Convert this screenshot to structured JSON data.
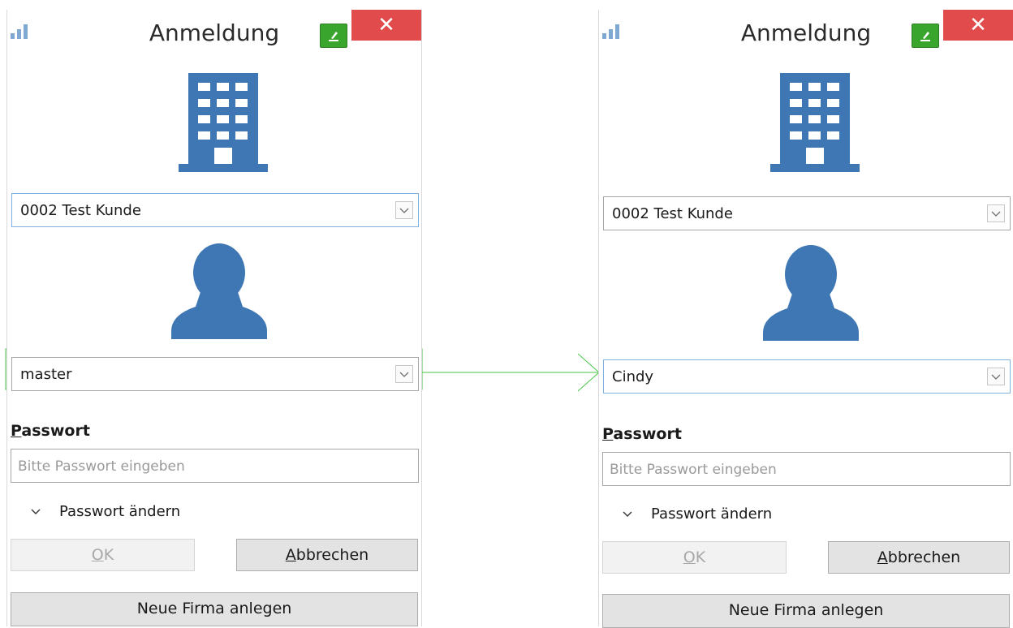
{
  "dialogs": [
    {
      "title": "Anmeldung",
      "close_glyph": "✕",
      "company": "0002 Test Kunde",
      "user": "master",
      "password_label_first": "P",
      "password_label_rest": "asswort",
      "password_placeholder": "Bitte Passwort eingeben",
      "change_password": "Passwort ändern",
      "ok_label_first": "O",
      "ok_label_rest": "K",
      "cancel_label_first": "A",
      "cancel_label_rest": "bbrechen",
      "new_company": "Neue Firma anlegen"
    },
    {
      "title": "Anmeldung",
      "close_glyph": "✕",
      "company": "0002 Test Kunde",
      "user": "Cindy",
      "password_label_first": "P",
      "password_label_rest": "asswort",
      "password_placeholder": "Bitte Passwort eingeben",
      "change_password": "Passwort ändern",
      "ok_label_first": "O",
      "ok_label_rest": "K",
      "cancel_label_first": "A",
      "cancel_label_rest": "bbrechen",
      "new_company": "Neue Firma anlegen"
    }
  ],
  "icons": {
    "signal": "signal-icon",
    "green_button": "sign-icon",
    "building": "building-icon",
    "person": "user-icon",
    "dropdown": "chevron-down-icon",
    "expander": "chevron-down-icon"
  },
  "colors": {
    "close_button": "#e24b4b",
    "icon_blue": "#3e77b3",
    "annotation_green": "#49c649"
  }
}
